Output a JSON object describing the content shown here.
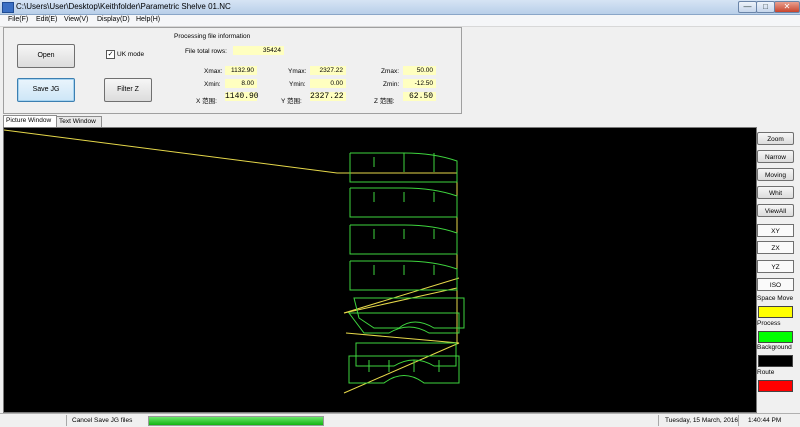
{
  "window": {
    "title": "C:\\Users\\User\\Desktop\\Keithfolder\\Parametric Shelve 01.NC",
    "minimize_glyph": "—",
    "maximize_glyph": "□",
    "close_glyph": "✕"
  },
  "menu": [
    "File(F)",
    "Edit(E)",
    "View(V)",
    "Display(D)",
    "Help(H)"
  ],
  "controls": {
    "open_label": "Open",
    "save_label": "Save JG",
    "uk_mode_label": "UK mode",
    "uk_mode_checked": true,
    "check_glyph": "✓",
    "filter_label": "Filter Z"
  },
  "info": {
    "heading": "Processing file information",
    "total_rows_label": "File total rows:",
    "total_rows": "35424",
    "xmax_label": "Xmax:",
    "xmax": "1132.90",
    "xmin_label": "Xmin:",
    "xmin": "8.00",
    "xrange_label": "X 范围:",
    "xrange": "1140.90",
    "ymax_label": "Ymax:",
    "ymax": "2327.22",
    "ymin_label": "Ymin:",
    "ymin": "0.00",
    "yrange_label": "Y 范围:",
    "yrange": "2327.22",
    "zmax_label": "Zmax:",
    "zmax": "50.00",
    "zmin_label": "Zmin:",
    "zmin": "-12.50",
    "zrange_label": "Z 范围:",
    "zrange": "62.50"
  },
  "tabs": [
    "Picture Window",
    "Text Window"
  ],
  "view_buttons": [
    "Zoom",
    "Narrow",
    "Moving",
    "Whit",
    "ViewAll"
  ],
  "plane_buttons": [
    "XY",
    "ZX",
    "YZ",
    "ISO"
  ],
  "colors": [
    {
      "label": "Space Move",
      "hex": "#ffff00"
    },
    {
      "label": "Process",
      "hex": "#00ff00"
    },
    {
      "label": "Background",
      "hex": "#000000"
    },
    {
      "label": "Route",
      "hex": "#ff0000"
    }
  ],
  "toolpath": {
    "move_color": "#e6d84a",
    "process_color": "#3ed43e"
  },
  "status": {
    "message": "Cancel Save JG files",
    "progress_fraction": 1.0,
    "date": "Tuesday, 15 March, 2016",
    "time": "1:40:44 PM"
  }
}
